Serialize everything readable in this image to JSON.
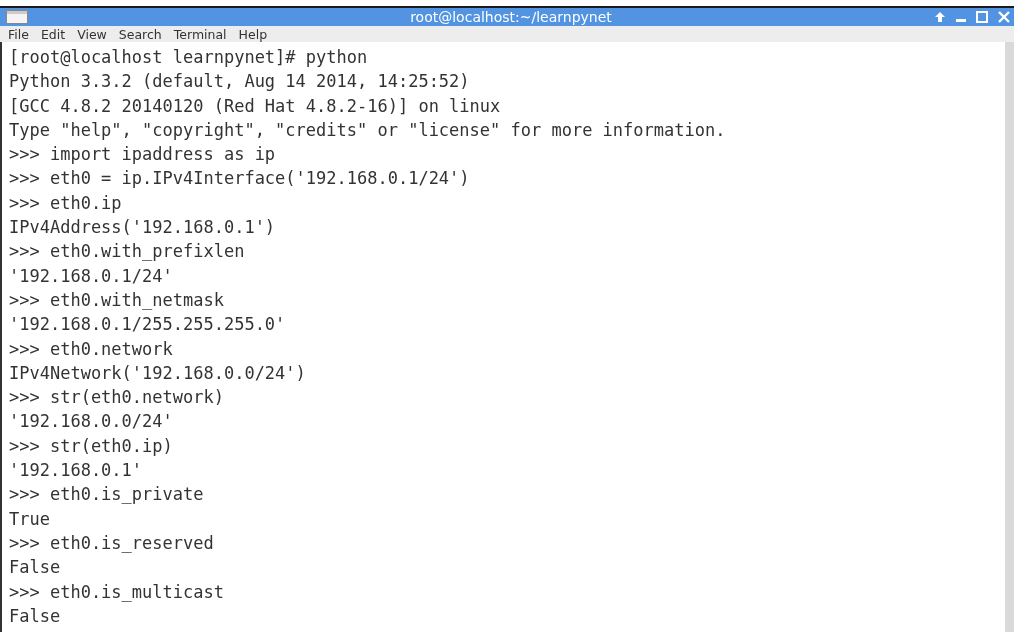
{
  "window": {
    "title": "root@localhost:~/learnpynet"
  },
  "menu": [
    "File",
    "Edit",
    "View",
    "Search",
    "Terminal",
    "Help"
  ],
  "terminal": {
    "lines": [
      "[root@localhost learnpynet]# python",
      "Python 3.3.2 (default, Aug 14 2014, 14:25:52)",
      "[GCC 4.8.2 20140120 (Red Hat 4.8.2-16)] on linux",
      "Type \"help\", \"copyright\", \"credits\" or \"license\" for more information.",
      ">>> import ipaddress as ip",
      ">>> eth0 = ip.IPv4Interface('192.168.0.1/24')",
      ">>> eth0.ip",
      "IPv4Address('192.168.0.1')",
      ">>> eth0.with_prefixlen",
      "'192.168.0.1/24'",
      ">>> eth0.with_netmask",
      "'192.168.0.1/255.255.255.0'",
      ">>> eth0.network",
      "IPv4Network('192.168.0.0/24')",
      ">>> str(eth0.network)",
      "'192.168.0.0/24'",
      ">>> str(eth0.ip)",
      "'192.168.0.1'",
      ">>> eth0.is_private",
      "True",
      ">>> eth0.is_reserved",
      "False",
      ">>> eth0.is_multicast",
      "False"
    ]
  }
}
